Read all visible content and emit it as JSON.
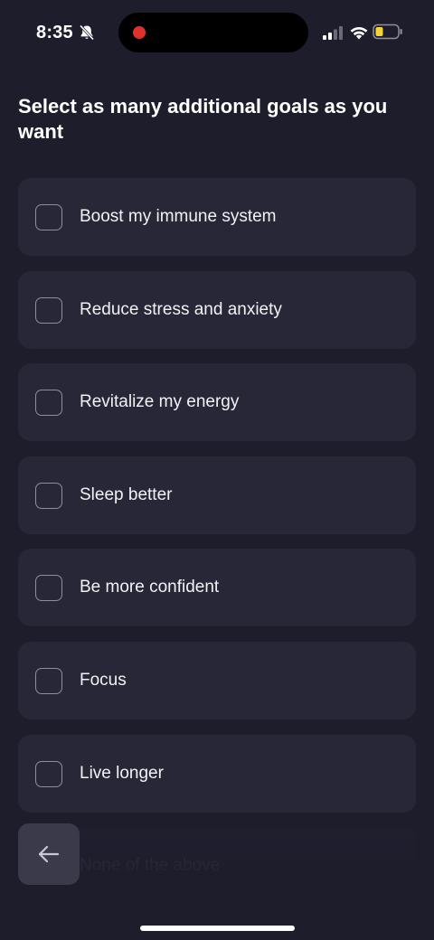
{
  "status_bar": {
    "time": "8:35",
    "icons": [
      "bell-slash-icon",
      "cellular-signal-icon",
      "wifi-icon",
      "battery-low-icon"
    ],
    "recording_indicator_color": "#e0322b",
    "battery_color": "#f5d33a"
  },
  "page": {
    "title": "Select as many additional goals as you want"
  },
  "goals": [
    {
      "label": "Boost my immune system",
      "checked": false
    },
    {
      "label": "Reduce stress and anxiety",
      "checked": false
    },
    {
      "label": "Revitalize my energy",
      "checked": false
    },
    {
      "label": "Sleep better",
      "checked": false
    },
    {
      "label": "Be more confident",
      "checked": false
    },
    {
      "label": "Focus",
      "checked": false
    },
    {
      "label": "Live longer",
      "checked": false
    },
    {
      "label": "None of the above",
      "checked": false
    }
  ],
  "navigation": {
    "back_icon": "arrow-left-icon"
  },
  "colors": {
    "background": "#1d1d2c",
    "card": "#272738",
    "back_button": "#3a3a4b"
  }
}
